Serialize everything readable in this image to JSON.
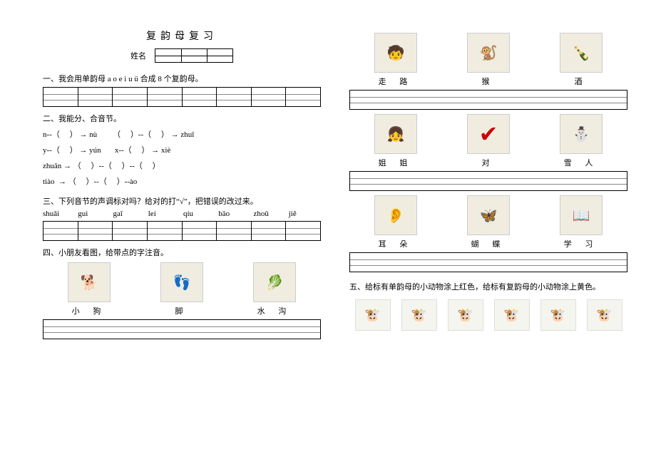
{
  "title": "复韵母复习",
  "nameLabel": "姓名",
  "section1": {
    "heading": "一、我会用单韵母 a o e i u ü 合成 8 个复韵母。"
  },
  "section2": {
    "heading": "二、我能分、合音节。",
    "rows": [
      "n--（     ） → nù        （     ）--（     ） → zhuī",
      "y--（     ） → yún       x--（     ） → xiè",
      "zhuān → （     ）--（     ）--（     ）",
      "tiào  → （     ）--（     ）--ào"
    ]
  },
  "section3": {
    "heading": "三、下列音节的声调标对吗？给对的打“√”，把错误的改过来。",
    "syllables": [
      "shuǎi",
      "guì",
      "gaī",
      "leí",
      "qíu",
      "bāo",
      "zhoǔ",
      "jiě"
    ]
  },
  "section4": {
    "heading": "四、小朋友看图，给带点的字注音。",
    "rows": [
      {
        "icons": [
          "🐕",
          "👣",
          "🥬"
        ],
        "labels": [
          "小 狗",
          "脚",
          "水 沟"
        ]
      },
      {
        "icons": [
          "🧒",
          "🐒",
          "🍾"
        ],
        "labels": [
          "走 路",
          "猴",
          "酒"
        ]
      },
      {
        "icons": [
          "👧",
          "✔",
          "⛄"
        ],
        "labels": [
          "姐 姐",
          "对",
          "雪 人"
        ]
      },
      {
        "icons": [
          "👂",
          "🦋",
          "📖"
        ],
        "labels": [
          "耳 朵",
          "蝴 蝶",
          "学 习"
        ]
      }
    ]
  },
  "section5": {
    "heading": "五、给标有单韵母的小动物涂上红色，给标有复韵母的小动物涂上黄色。",
    "animals": [
      "🐮",
      "🐮",
      "🐮",
      "🐮",
      "🐮",
      "🐮"
    ]
  }
}
